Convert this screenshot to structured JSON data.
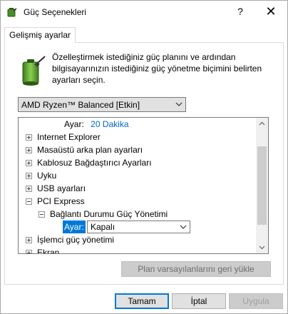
{
  "window": {
    "title": "Güç Seçenekleri",
    "help_label": "?",
    "close_label": "✕"
  },
  "tab": {
    "label": "Gelişmiş ayarlar"
  },
  "description": "Özelleştirmek istediğiniz güç planını ve ardından bilgisayarınızın istediğiniz güç yönetme biçimini belirten ayarları seçin.",
  "plan_select": {
    "value": "AMD Ryzen™ Balanced [Etkin]"
  },
  "tree": {
    "top_setting": {
      "label": "Ayar:",
      "value": "20 Dakika"
    },
    "items": [
      {
        "label": "Internet Explorer",
        "state": "collapsed"
      },
      {
        "label": "Masaüstü arka plan ayarları",
        "state": "collapsed"
      },
      {
        "label": "Kablosuz Bağdaştırıcı Ayarları",
        "state": "collapsed"
      },
      {
        "label": "Uyku",
        "state": "collapsed"
      },
      {
        "label": "USB ayarları",
        "state": "collapsed"
      },
      {
        "label": "PCI Express",
        "state": "expanded"
      },
      {
        "label": "Bağlantı Durumu Güç Yönetimi",
        "state": "expanded"
      },
      {
        "label": "İşlemci güç yönetimi",
        "state": "collapsed"
      },
      {
        "label": "Ekran",
        "state": "collapsed"
      }
    ],
    "sub_setting": {
      "label": "Ayar:",
      "value": "Kapalı"
    }
  },
  "buttons": {
    "restore": "Plan varsayılanlarını geri yükle",
    "ok": "Tamam",
    "cancel": "İptal",
    "apply": "Uygula"
  },
  "colors": {
    "accent": "#0078d7",
    "link": "#0066cc"
  },
  "icons": {
    "app": "power-options-icon",
    "battery": "battery-power-icon",
    "chevron": "chevron-down-icon"
  }
}
